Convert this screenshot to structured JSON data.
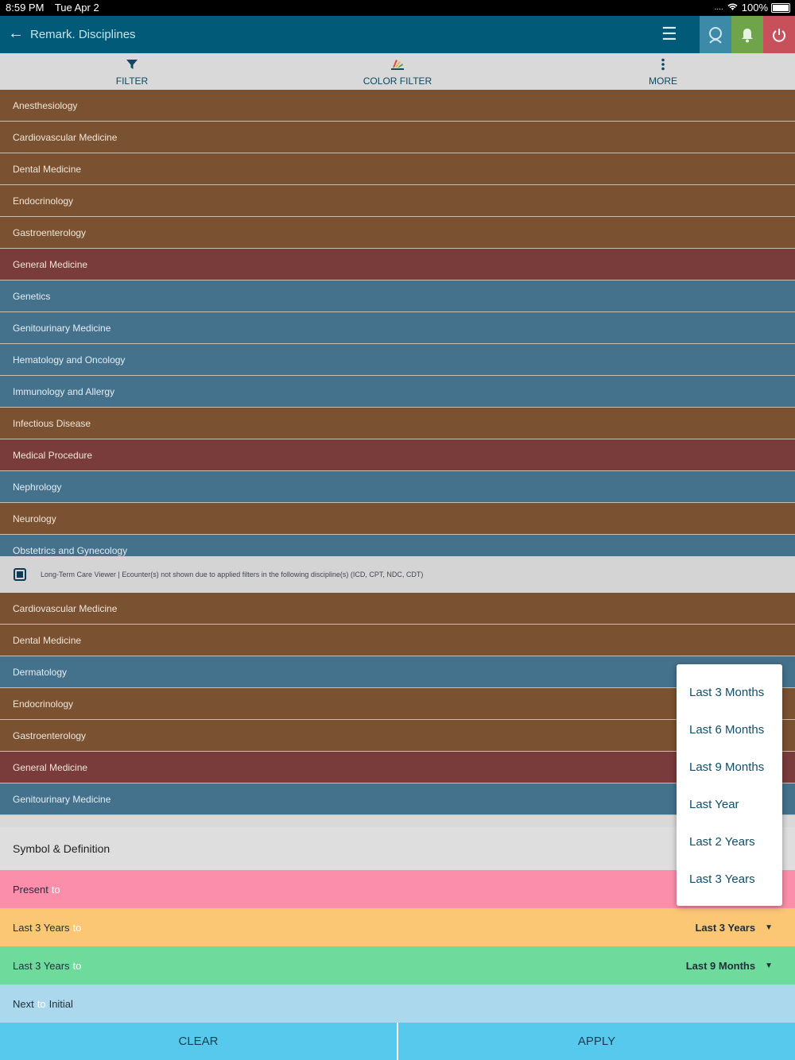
{
  "status_bar": {
    "time": "8:59 PM",
    "date": "Tue Apr 2",
    "signal": "....",
    "battery": "100%"
  },
  "app_bar": {
    "title": "Remark. Disciplines"
  },
  "toolbar": {
    "filter_label": "FILTER",
    "color_filter_label": "COLOR FILTER",
    "more_label": "MORE"
  },
  "colors": {
    "brown": "#7a5131",
    "red": "#7a3b3b",
    "blue": "#44718c",
    "header": "#005a78"
  },
  "list_top": {
    "items": [
      {
        "label": "Anesthesiology",
        "color": "brown"
      },
      {
        "label": "Cardiovascular Medicine",
        "color": "brown"
      },
      {
        "label": "Dental Medicine",
        "color": "brown"
      },
      {
        "label": "Endocrinology",
        "color": "brown"
      },
      {
        "label": "Gastroenterology",
        "color": "brown"
      },
      {
        "label": "General Medicine",
        "color": "red"
      },
      {
        "label": "Genetics",
        "color": "blue"
      },
      {
        "label": "Genitourinary Medicine",
        "color": "blue"
      },
      {
        "label": "Hematology and Oncology",
        "color": "blue"
      },
      {
        "label": "Immunology and Allergy",
        "color": "blue"
      },
      {
        "label": "Infectious Disease",
        "color": "brown"
      },
      {
        "label": "Medical Procedure",
        "color": "red"
      },
      {
        "label": "Nephrology",
        "color": "blue"
      },
      {
        "label": "Neurology",
        "color": "brown"
      },
      {
        "label": "Obstetrics and Gynecology",
        "color": "blue"
      }
    ]
  },
  "notice": {
    "text": "Long-Term Care Viewer | Ecounter(s) not shown due to applied filters in the following discipline(s) (ICD, CPT, NDC, CDT)"
  },
  "list_bottom": {
    "items": [
      {
        "label": "Cardiovascular Medicine",
        "color": "brown"
      },
      {
        "label": "Dental Medicine",
        "color": "brown"
      },
      {
        "label": "Dermatology",
        "color": "blue"
      },
      {
        "label": "Endocrinology",
        "color": "brown"
      },
      {
        "label": "Gastroenterology",
        "color": "brown"
      },
      {
        "label": "General Medicine",
        "color": "red"
      },
      {
        "label": "Genitourinary Medicine",
        "color": "blue"
      }
    ]
  },
  "symbol_definition": {
    "header": "Symbol & Definition",
    "rows": [
      {
        "from": "Present",
        "to": "to",
        "value": "",
        "bg": "#fb8fab"
      },
      {
        "from": "Last 3 Years",
        "to": "to",
        "value": "Last 3 Years",
        "bg": "#fbc775"
      },
      {
        "from": "Last 3 Years",
        "to": "to",
        "value": "Last 9 Months",
        "bg": "#6edb9c"
      },
      {
        "from": "Next",
        "to": "to",
        "value": "Initial",
        "bg": "#acd8ed"
      }
    ]
  },
  "dropdown": {
    "options": [
      "Last 3 Months",
      "Last 6 Months",
      "Last 9 Months",
      "Last Year",
      "Last 2 Years",
      "Last 3 Years"
    ]
  },
  "bottom_bar": {
    "clear_label": "CLEAR",
    "apply_label": "APPLY"
  }
}
